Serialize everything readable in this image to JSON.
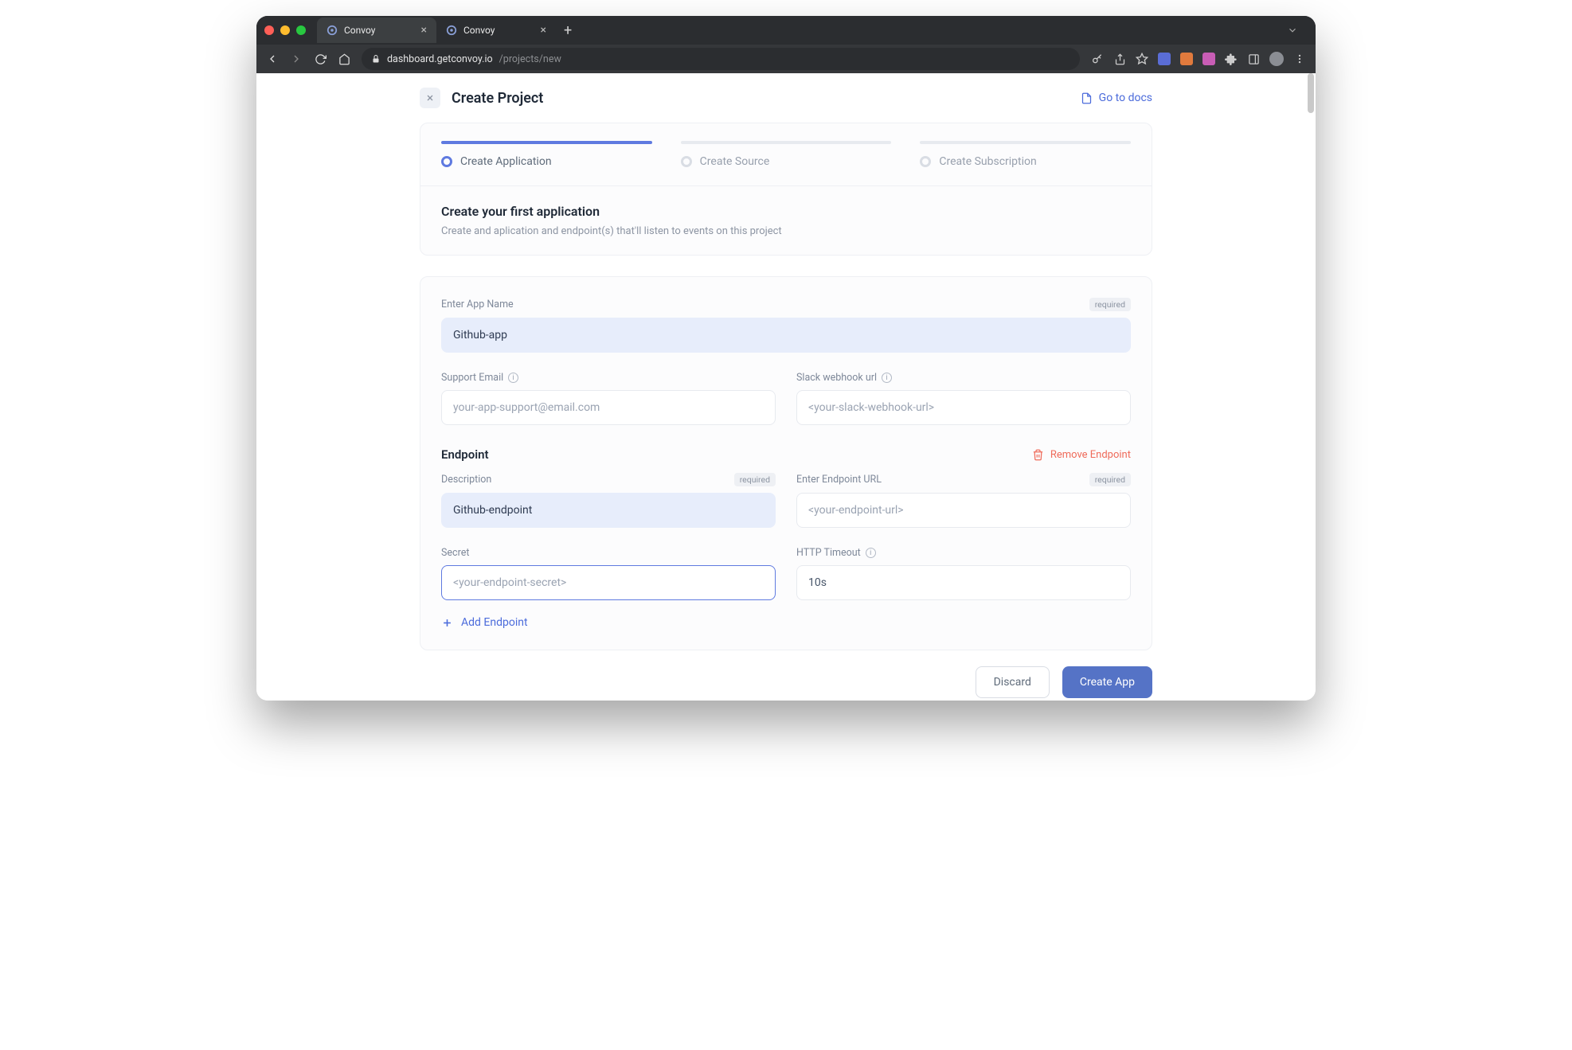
{
  "browser": {
    "tabs": [
      {
        "title": "Convoy",
        "active": true
      },
      {
        "title": "Convoy",
        "active": false
      }
    ],
    "url_host": "dashboard.getconvoy.io",
    "url_path": "/projects/new"
  },
  "header": {
    "title": "Create Project",
    "docs_label": "Go to docs"
  },
  "steps": [
    {
      "label": "Create Application",
      "active": true
    },
    {
      "label": "Create Source",
      "active": false
    },
    {
      "label": "Create Subscription",
      "active": false
    }
  ],
  "intro": {
    "title": "Create your first application",
    "subtitle": "Create and aplication and endpoint(s) that'll listen to events on this project"
  },
  "form": {
    "app_name": {
      "label": "Enter App Name",
      "value": "Github-app",
      "required": "required"
    },
    "support_email": {
      "label": "Support Email",
      "placeholder": "your-app-support@email.com"
    },
    "slack_url": {
      "label": "Slack webhook url",
      "placeholder": "<your-slack-webhook-url>"
    },
    "endpoint_title": "Endpoint",
    "remove_label": "Remove Endpoint",
    "description": {
      "label": "Description",
      "value": "Github-endpoint",
      "required": "required"
    },
    "endpoint_url": {
      "label": "Enter Endpoint URL",
      "placeholder": "<your-endpoint-url>",
      "required": "required"
    },
    "secret": {
      "label": "Secret",
      "placeholder": "<your-endpoint-secret>"
    },
    "timeout": {
      "label": "HTTP Timeout",
      "value": "10s"
    },
    "add_endpoint": "Add Endpoint"
  },
  "actions": {
    "discard": "Discard",
    "create": "Create App"
  }
}
